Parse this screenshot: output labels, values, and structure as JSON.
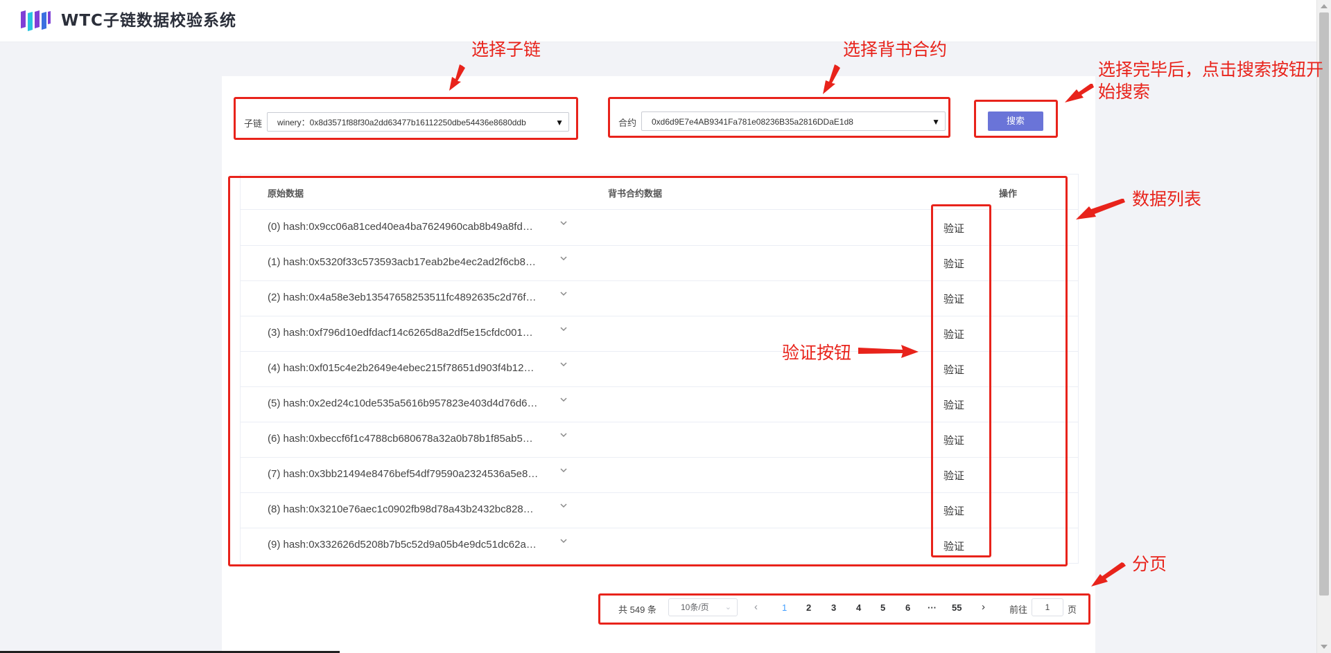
{
  "header": {
    "app_title": "WTC子链数据校验系统",
    "logo_icon": "bars-logo-icon"
  },
  "filters": {
    "subchain_label": "子链",
    "subchain_value": "winery：0x8d3571f88f30a2dd63477b16112250dbe54436e8680ddb",
    "contract_label": "合约",
    "contract_value": "0xd6d9E7e4AB9341Fa781e08236B35a2816DDaE1d8",
    "search_label": "搜索"
  },
  "table": {
    "headers": [
      "原始数据",
      "背书合约数据",
      "操作"
    ],
    "rows": [
      {
        "hash": "(0) hash:0x9cc06a81ced40ea4ba7624960cab8b49a8fd…",
        "action": "验证"
      },
      {
        "hash": "(1) hash:0x5320f33c573593acb17eab2be4ec2ad2f6cb8…",
        "action": "验证"
      },
      {
        "hash": "(2) hash:0x4a58e3eb13547658253511fc4892635c2d76f…",
        "action": "验证"
      },
      {
        "hash": "(3) hash:0xf796d10edfdacf14c6265d8a2df5e15cfdc001…",
        "action": "验证"
      },
      {
        "hash": "(4) hash:0xf015c4e2b2649e4ebec215f78651d903f4b12…",
        "action": "验证"
      },
      {
        "hash": "(5) hash:0x2ed24c10de535a5616b957823e403d4d76d6…",
        "action": "验证"
      },
      {
        "hash": "(6) hash:0xbeccf6f1c4788cb680678a32a0b78b1f85ab5…",
        "action": "验证"
      },
      {
        "hash": "(7) hash:0x3bb21494e8476bef54df79590a2324536a5e8…",
        "action": "验证"
      },
      {
        "hash": "(8) hash:0x3210e76aec1c0902fb98d78a43b2432bc828…",
        "action": "验证"
      },
      {
        "hash": "(9) hash:0x332626d5208b7b5c52d9a05b4e9dc51dc62a…",
        "action": "验证"
      }
    ]
  },
  "pagination": {
    "total": "共 549 条",
    "page_size": "10条/页",
    "pages": [
      "1",
      "2",
      "3",
      "4",
      "5",
      "6",
      "···",
      "55"
    ],
    "current_page": "1",
    "goto_label": "前往",
    "goto_value": "1",
    "page_unit": "页"
  },
  "annotations": {
    "select_subchain": "选择子链",
    "select_contract": "选择背书合约",
    "search_hint_line1": "选择完毕后，点击搜索按钮开",
    "search_hint_line2": "始搜索",
    "data_list": "数据列表",
    "verify_button": "验证按钮",
    "pagination": "分页"
  },
  "colors": {
    "annotation_red": "#e8231b",
    "primary_button": "#6a74d8",
    "active_page": "#409eff"
  }
}
